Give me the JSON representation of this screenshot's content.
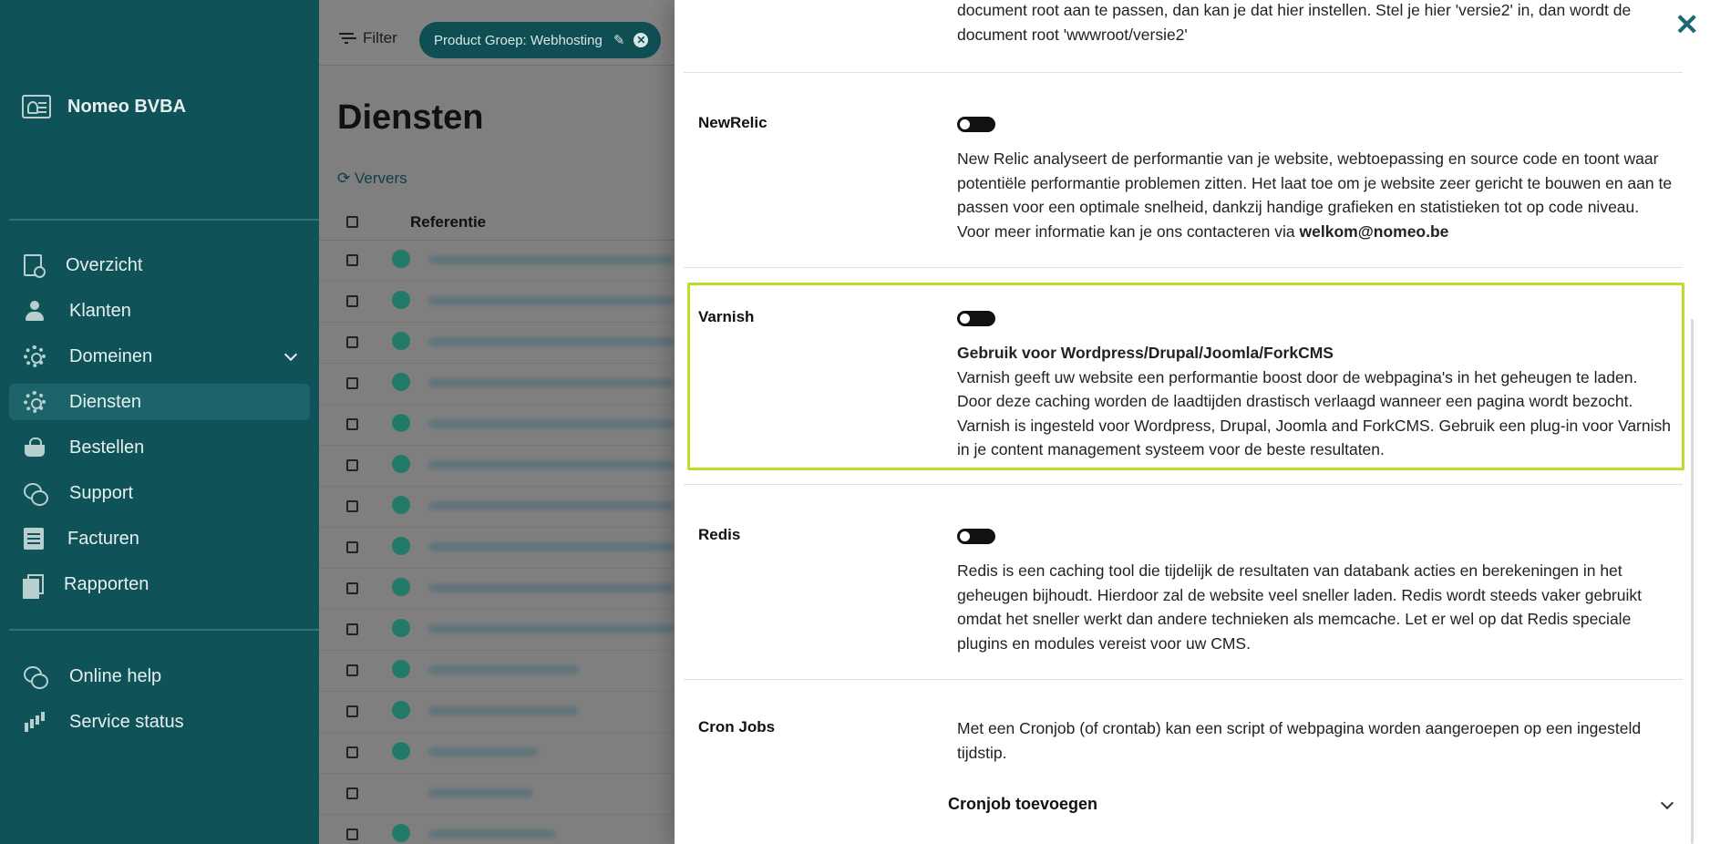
{
  "sidebar": {
    "company": "Nomeo BVBA",
    "items": [
      {
        "label": "Overzicht",
        "icon": "report-search-icon"
      },
      {
        "label": "Klanten",
        "icon": "users-icon"
      },
      {
        "label": "Domeinen",
        "icon": "gear-icon"
      },
      {
        "label": "Diensten",
        "icon": "gear-icon"
      },
      {
        "label": "Bestellen",
        "icon": "basket-icon"
      },
      {
        "label": "Support",
        "icon": "chat-icon"
      },
      {
        "label": "Facturen",
        "icon": "invoice-icon"
      },
      {
        "label": "Rapporten",
        "icon": "report-icon"
      }
    ],
    "footer_items": [
      {
        "label": "Online help",
        "icon": "chat-icon"
      },
      {
        "label": "Service status",
        "icon": "bar-chart-icon"
      }
    ]
  },
  "main": {
    "filter_label": "Filter",
    "filter_chip": "Product Groep: Webhosting",
    "title": "Diensten",
    "refresh_label": "Ververs",
    "column_reference": "Referentie"
  },
  "panel": {
    "docroot_text": "document root aan te passen, dan kan je dat hier instellen. Stel je hier 'versie2' in, dan wordt de document root 'wwwroot/versie2'",
    "newrelic": {
      "label": "NewRelic",
      "text": "New Relic analyseert de performantie van je website, webtoepassing en source code en toont waar potentiële performantie problemen zitten. Het laat toe om je website zeer gericht te bouwen en aan te passen voor een optimale snelheid, dankzij handige grafieken en statistieken tot op code niveau. Voor meer informatie kan je ons contacteren via",
      "email": "welkom@nomeo.be"
    },
    "varnish": {
      "label": "Varnish",
      "subtitle": "Gebruik voor Wordpress/Drupal/Joomla/ForkCMS",
      "text": "Varnish geeft uw website een performantie boost door de webpagina's in het geheugen te laden. Door deze caching worden de laadtijden drastisch verlaagd wanneer een pagina wordt bezocht. Varnish is ingesteld voor Wordpress, Drupal, Joomla and ForkCMS. Gebruik een plug-in voor Varnish in je content management systeem voor de beste resultaten."
    },
    "redis": {
      "label": "Redis",
      "text": "Redis is een caching tool die tijdelijk de resultaten van databank acties en berekeningen in het geheugen bijhoudt. Hierdoor zal de website veel sneller laden. Redis wordt steeds vaker gebruikt omdat het sneller werkt dan andere technieken als memcache. Let er wel op dat Redis speciale plugins en modules vereist voor uw CMS."
    },
    "cron": {
      "label": "Cron Jobs",
      "text": "Met een Cronjob (of crontab) kan een script of webpagina worden aangeroepen op een ingesteld tijdstip.",
      "add_label": "Cronjob toevoegen"
    },
    "close_symbol": "✕"
  },
  "colors": {
    "sidebar_bg": "#0f5257",
    "highlight": "#b8e02a",
    "accent": "#1a6a72"
  }
}
